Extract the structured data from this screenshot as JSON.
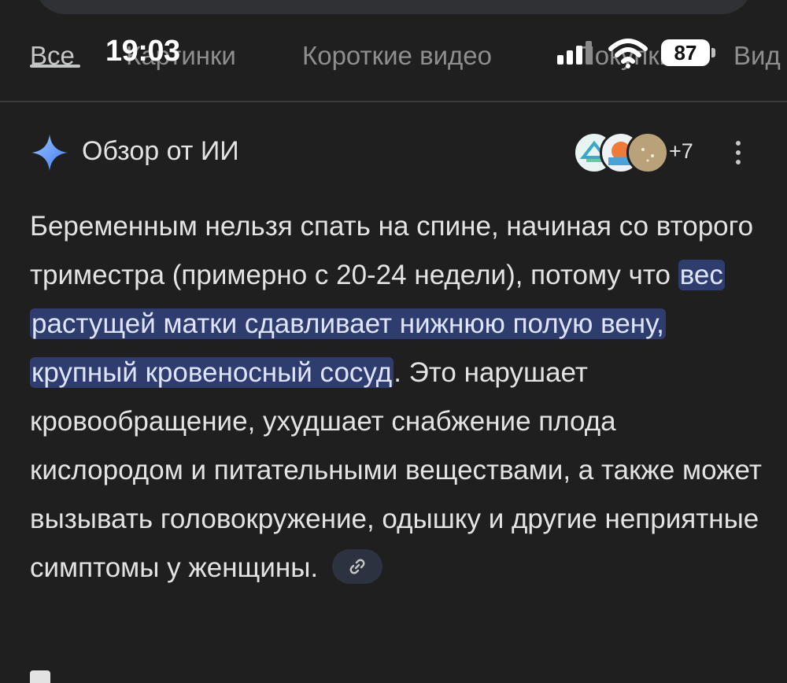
{
  "status_bar": {
    "time": "19:03",
    "battery": "87",
    "icons": [
      "signal-icon",
      "wifi-icon",
      "battery-icon"
    ]
  },
  "tabs": [
    {
      "label": "Все",
      "active": true
    },
    {
      "label": "Картинки",
      "active": false
    },
    {
      "label": "Короткие видео",
      "active": false
    },
    {
      "label": "Покупки",
      "active": false
    },
    {
      "label": "Вид",
      "active": false
    }
  ],
  "ai_overview": {
    "title": "Обзор от ИИ",
    "sources_more": "+7",
    "icons": [
      "sparkle-icon",
      "more-vert-icon"
    ]
  },
  "answer": {
    "part1": "Беременным нельзя спать на спине, начиная со второго триместра (примерно с 20-24 недели), потому что ",
    "highlight": "вес растущей матки сдавливает нижнюю полую вену, крупный кровеносный сосуд",
    "part2": ". Это нарушает кровообращение, ухудшает снабжение плода кислородом и питательными веществами, а также может вызывать головокружение, одышку и другие неприятные симптомы у женщины.",
    "link_icon": "link-icon"
  },
  "colors": {
    "background": "#1f1f1f",
    "highlight_bg": "#2f3d6e",
    "accent_blue": "#4a90f5"
  }
}
